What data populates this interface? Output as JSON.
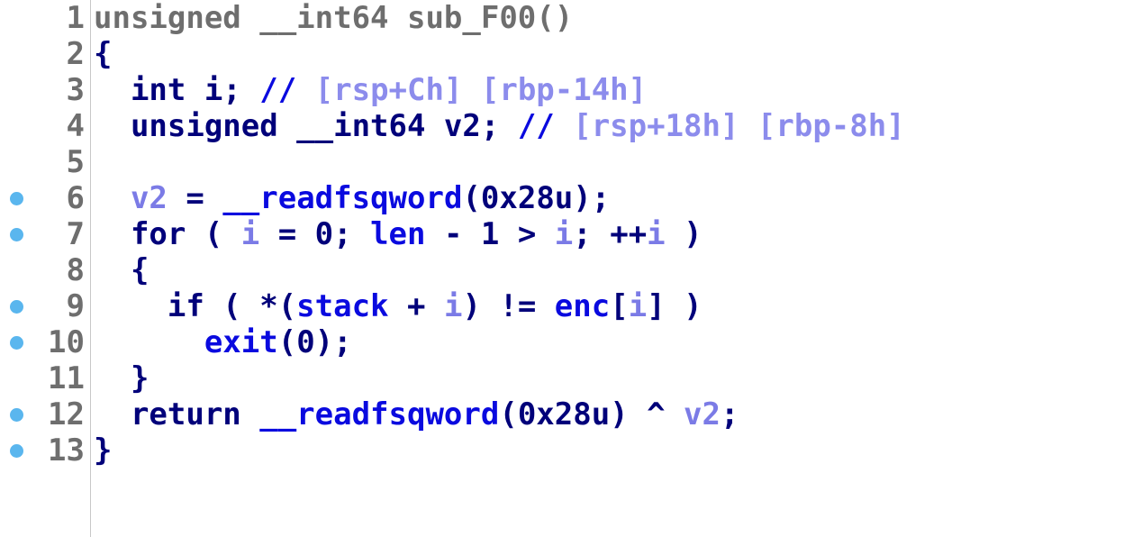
{
  "editor": {
    "lines": [
      {
        "num": "1",
        "breakpoint": false,
        "tokens": [
          {
            "t": "unsigned __int64 sub_F00()",
            "k": "dim"
          }
        ]
      },
      {
        "num": "2",
        "breakpoint": false,
        "tokens": [
          {
            "t": "{",
            "k": "kw"
          }
        ]
      },
      {
        "num": "3",
        "breakpoint": false,
        "tokens": [
          {
            "t": "  int i; ",
            "k": "kw"
          },
          {
            "t": "// ",
            "k": "cm"
          },
          {
            "t": "[rsp+Ch] [rbp-14h]",
            "k": "cmv"
          }
        ]
      },
      {
        "num": "4",
        "breakpoint": false,
        "tokens": [
          {
            "t": "  unsigned __int64 v2; ",
            "k": "kw"
          },
          {
            "t": "// ",
            "k": "cm"
          },
          {
            "t": "[rsp+18h] [rbp-8h]",
            "k": "cmv"
          }
        ]
      },
      {
        "num": "5",
        "breakpoint": false,
        "tokens": []
      },
      {
        "num": "6",
        "breakpoint": true,
        "tokens": [
          {
            "t": "  ",
            "k": "plain"
          },
          {
            "t": "v2",
            "k": "var"
          },
          {
            "t": " = ",
            "k": "op"
          },
          {
            "t": "__readfsqword",
            "k": "fn"
          },
          {
            "t": "(0x28u);",
            "k": "plain"
          }
        ]
      },
      {
        "num": "7",
        "breakpoint": true,
        "tokens": [
          {
            "t": "  for ( ",
            "k": "kw"
          },
          {
            "t": "i",
            "k": "var"
          },
          {
            "t": " = 0; ",
            "k": "plain"
          },
          {
            "t": "len",
            "k": "fn"
          },
          {
            "t": " - 1 > ",
            "k": "plain"
          },
          {
            "t": "i",
            "k": "var"
          },
          {
            "t": "; ++",
            "k": "plain"
          },
          {
            "t": "i",
            "k": "var"
          },
          {
            "t": " )",
            "k": "plain"
          }
        ]
      },
      {
        "num": "8",
        "breakpoint": false,
        "tokens": [
          {
            "t": "  {",
            "k": "kw"
          }
        ]
      },
      {
        "num": "9",
        "breakpoint": true,
        "tokens": [
          {
            "t": "    if ( *(",
            "k": "kw"
          },
          {
            "t": "stack",
            "k": "fn"
          },
          {
            "t": " + ",
            "k": "plain"
          },
          {
            "t": "i",
            "k": "var"
          },
          {
            "t": ") != ",
            "k": "plain"
          },
          {
            "t": "enc",
            "k": "fn"
          },
          {
            "t": "[",
            "k": "plain"
          },
          {
            "t": "i",
            "k": "var"
          },
          {
            "t": "] )",
            "k": "plain"
          }
        ]
      },
      {
        "num": "10",
        "breakpoint": true,
        "tokens": [
          {
            "t": "      ",
            "k": "plain"
          },
          {
            "t": "exit",
            "k": "fn"
          },
          {
            "t": "(0);",
            "k": "plain"
          }
        ]
      },
      {
        "num": "11",
        "breakpoint": false,
        "tokens": [
          {
            "t": "  }",
            "k": "kw"
          }
        ]
      },
      {
        "num": "12",
        "breakpoint": true,
        "tokens": [
          {
            "t": "  return ",
            "k": "kw"
          },
          {
            "t": "__readfsqword",
            "k": "fn"
          },
          {
            "t": "(0x28u) ^ ",
            "k": "plain"
          },
          {
            "t": "v2",
            "k": "var"
          },
          {
            "t": ";",
            "k": "plain"
          }
        ]
      },
      {
        "num": "13",
        "breakpoint": true,
        "tokens": [
          {
            "t": "}",
            "k": "kw"
          }
        ]
      }
    ]
  },
  "colors": {
    "keyword": "#00007a",
    "function": "#0a0adf",
    "variable": "#7b7be6",
    "comment_value": "#8c8cec",
    "line_number": "#6e6e6e",
    "breakpoint": "#5ab6ee",
    "gutter_divider": "#c8c8c8"
  }
}
